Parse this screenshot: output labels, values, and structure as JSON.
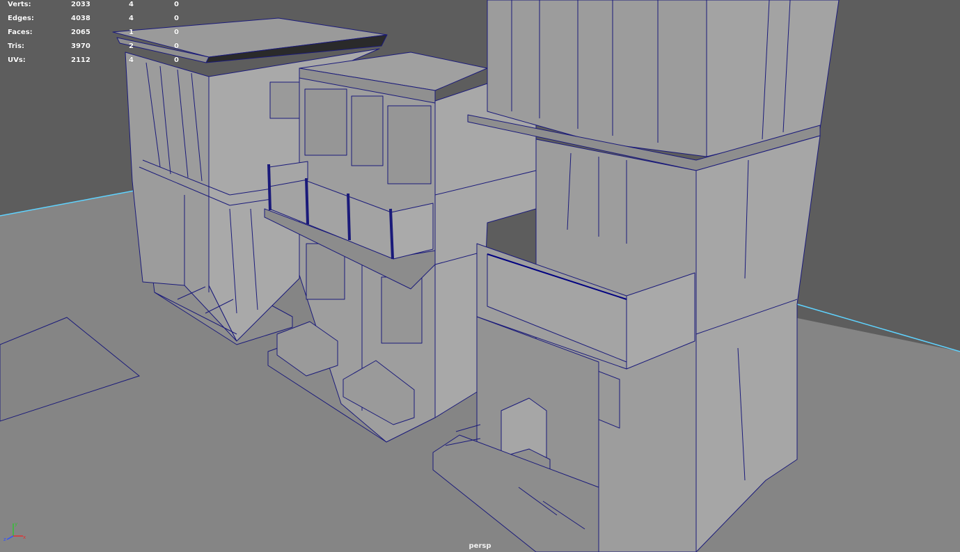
{
  "hud": {
    "rows": [
      {
        "label": "Verts:",
        "total": "2033",
        "selected": "4",
        "uv": "0"
      },
      {
        "label": "Edges:",
        "total": "4038",
        "selected": "4",
        "uv": "0"
      },
      {
        "label": "Faces:",
        "total": "2065",
        "selected": "1",
        "uv": "0"
      },
      {
        "label": "Tris:",
        "total": "3970",
        "selected": "2",
        "uv": "0"
      },
      {
        "label": "UVs:",
        "total": "2112",
        "selected": "4",
        "uv": "0"
      }
    ]
  },
  "viewport": {
    "camera_name": "persp",
    "colors": {
      "background": "#5d5d5d",
      "ground": "#858585",
      "wall_light": "#a8a8a8",
      "wall_mid": "#9a9a9a",
      "wall_dark": "#8a8a8a",
      "wireframe": "#1a1a7a",
      "grid_axis": "#5fd3ff",
      "selection": "#000080"
    }
  },
  "axis_gizmo": {
    "icon": "xyz-axis-icon",
    "x_color": "#e03030",
    "y_color": "#30c030",
    "z_color": "#3050ff"
  }
}
